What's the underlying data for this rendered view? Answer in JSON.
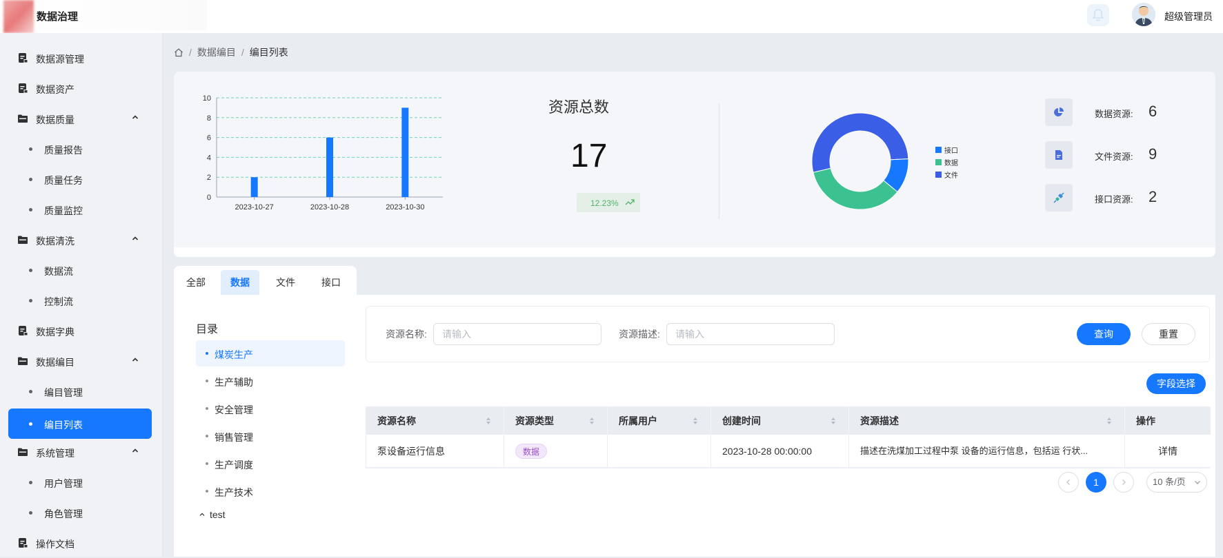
{
  "header": {
    "app_title": "数据治理",
    "user_name": "超级管理员"
  },
  "sidebar": {
    "items": [
      {
        "label": "数据源管理",
        "type": "menu"
      },
      {
        "label": "数据资产",
        "type": "menu"
      },
      {
        "label": "数据质量",
        "type": "group"
      },
      {
        "label": "质量报告",
        "type": "sub"
      },
      {
        "label": "质量任务",
        "type": "sub"
      },
      {
        "label": "质量监控",
        "type": "sub"
      },
      {
        "label": "数据清洗",
        "type": "group"
      },
      {
        "label": "数据流",
        "type": "sub"
      },
      {
        "label": "控制流",
        "type": "sub"
      },
      {
        "label": "数据字典",
        "type": "menu"
      },
      {
        "label": "数据编目",
        "type": "group"
      },
      {
        "label": "编目管理",
        "type": "sub"
      },
      {
        "label": "编目列表",
        "type": "sub",
        "active": true
      },
      {
        "label": "系统管理",
        "type": "group"
      },
      {
        "label": "用户管理",
        "type": "sub"
      },
      {
        "label": "角色管理",
        "type": "sub"
      },
      {
        "label": "操作文档",
        "type": "menu"
      }
    ]
  },
  "breadcrumb": [
    "数据编目",
    "编目列表"
  ],
  "stats": {
    "total_title": "资源总数",
    "total_value": "17",
    "growth": "12.23%",
    "resources": [
      {
        "label": "数据资源:",
        "value": "6",
        "icon": "pie-chart-icon"
      },
      {
        "label": "文件资源:",
        "value": "9",
        "icon": "file-icon"
      },
      {
        "label": "接口资源:",
        "value": "2",
        "icon": "plug-icon"
      }
    ],
    "accent": "#1677ff",
    "colors": {
      "接口": "#1677ff",
      "数据": "#3cc191",
      "文件": "#3a5ee6"
    }
  },
  "chart_data": [
    {
      "type": "bar",
      "categories": [
        "2023-10-27",
        "2023-10-28",
        "2023-10-30"
      ],
      "values": [
        2,
        6,
        9
      ],
      "yticks": [
        0,
        2,
        4,
        6,
        8,
        10
      ],
      "ylim": [
        0,
        10
      ],
      "grid": true
    },
    {
      "type": "pie",
      "labels": [
        "接口",
        "数据",
        "文件"
      ],
      "values": [
        2,
        6,
        9
      ],
      "legend": "right"
    }
  ],
  "tabs": [
    "全部",
    "数据",
    "文件",
    "接口"
  ],
  "active_tab": "数据",
  "directory": {
    "title": "目录",
    "items": [
      "煤炭生产",
      "生产辅助",
      "安全管理",
      "销售管理",
      "生产调度",
      "生产技术"
    ],
    "tree_node": "test"
  },
  "search": {
    "name_label": "资源名称:",
    "name_placeholder": "请输入",
    "desc_label": "资源描述:",
    "desc_placeholder": "请输入",
    "query_button": "查询",
    "reset_button": "重置",
    "field_select_button": "字段选择"
  },
  "table": {
    "columns": [
      "资源名称",
      "资源类型",
      "所属用户",
      "创建时间",
      "资源描述",
      "操作"
    ],
    "rows": [
      {
        "name": "泵设备运行信息",
        "type": "数据",
        "user": "",
        "created": "2023-10-28 00:00:00",
        "desc": "描述在洗煤加工过程中泵 设备的运行信息，包括运 行状...",
        "action": "详情"
      }
    ]
  },
  "pagination": {
    "current": "1",
    "page_size": "10 条/页"
  }
}
